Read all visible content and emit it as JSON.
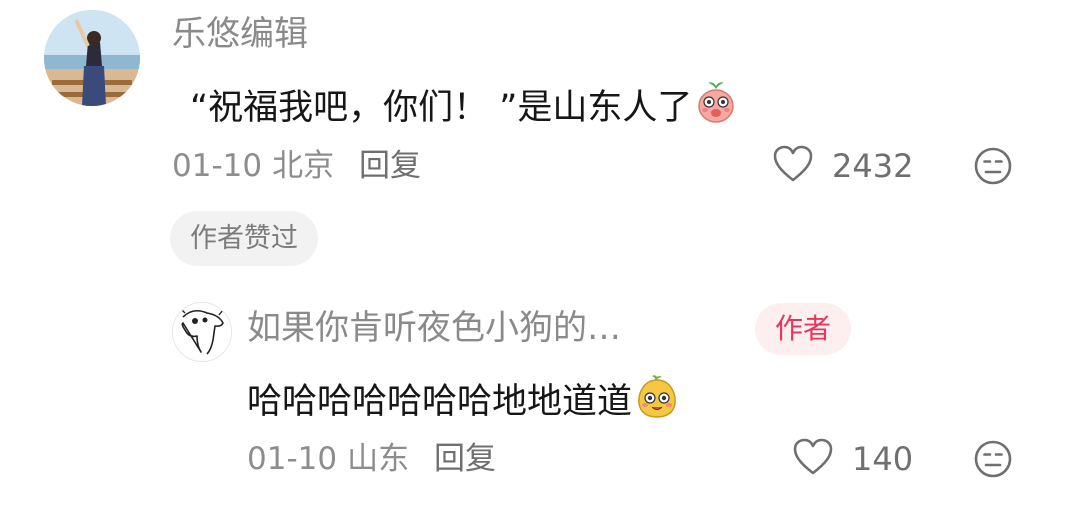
{
  "comment": {
    "username": "乐悠编辑",
    "text": "“祝福我吧，你们！ ”是山东人了",
    "date": "01-10",
    "location": "北京",
    "reply_label": "回复",
    "like_count": "2432",
    "author_liked_label": "作者赞过"
  },
  "reply": {
    "username": "如果你肯听夜色小狗的…",
    "author_badge": "作者",
    "text": "哈哈哈哈哈哈哈地地道道",
    "date": "01-10",
    "location": "山东",
    "reply_label": "回复",
    "like_count": "140"
  },
  "colors": {
    "accent_red": "#e8365a",
    "badge_bg": "#fdeef0",
    "muted_text": "#8d8d8d"
  },
  "icons": [
    "avatar-photo",
    "heart-outline-icon",
    "dislike-face-icon",
    "peach-emoji-icon",
    "yellow-sprite-emoji-icon",
    "dog-sketch-avatar"
  ]
}
